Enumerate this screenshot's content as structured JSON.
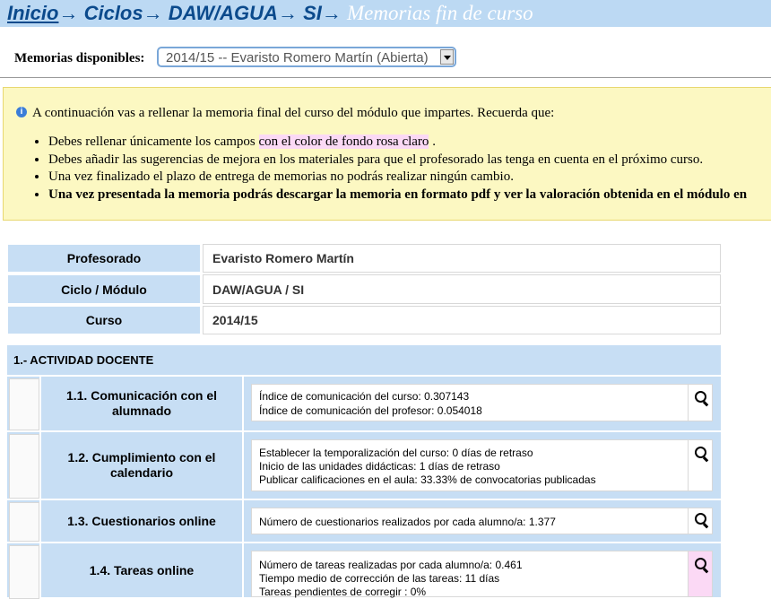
{
  "breadcrumb": {
    "inicio": "Inicio",
    "arrow": "→",
    "ciclos": "Ciclos",
    "modulo": "DAW/AGUA",
    "si": "SI",
    "current": "Memorias fin de curso"
  },
  "selector": {
    "label": "Memorias disponibles:",
    "value": "2014/15 -- Evaristo Romero Martín (Abierta)"
  },
  "info": {
    "intro": "A continuación vas a rellenar la memoria final del curso del módulo que impartes. Recuerda que:",
    "item1_pre": "Debes rellenar únicamente los campos ",
    "item1_pink": "con el color de fondo rosa claro",
    "item1_post": " .",
    "item2": "Debes añadir las sugerencias de mejora en los materiales para que el profesorado las tenga en cuenta en el próximo curso.",
    "item3": "Una vez finalizado el plazo de entrega de memorias no podrás realizar ningún cambio.",
    "item4": "Una vez presentada la memoria podrás descargar la memoria en formato pdf y ver la valoración obtenida en el módulo en"
  },
  "summary": [
    {
      "label": "Profesorado",
      "value": "Evaristo Romero Martín"
    },
    {
      "label": "Ciclo / Módulo",
      "value": "DAW/AGUA / SI"
    },
    {
      "label": "Curso",
      "value": "2014/15"
    }
  ],
  "section1": {
    "title": "1.- ACTIVIDAD DOCENTE",
    "items": [
      {
        "title": "1.1. Comunicación con el alumnado",
        "lines": [
          "Índice de comunicación del curso: 0.307143",
          "Índice de comunicación del profesor: 0.054018"
        ]
      },
      {
        "title": "1.2. Cumplimiento con el calendario",
        "lines": [
          "Establecer la temporalización del curso: 0 días de retraso",
          "Inicio de las unidades didácticas: 1 días de retraso",
          "Publicar calificaciones en el aula: 33.33% de convocatorias publicadas"
        ]
      },
      {
        "title": "1.3. Cuestionarios online",
        "lines": [
          "Número de cuestionarios realizados por cada alumno/a: 1.377"
        ]
      },
      {
        "title": "1.4. Tareas online",
        "lines": [
          "Número de tareas realizadas por cada alumno/a: 0.461",
          "Tiempo medio de corrección de las tareas: 11 días",
          "Tareas pendientes de corregir : 0%"
        ]
      }
    ]
  },
  "colors": {
    "header_bg": "#bcd9f3",
    "cell_bg": "#c7def4",
    "info_bg": "#fcf8c2",
    "pink": "#fbd9f5",
    "link": "#0b4a8c"
  },
  "icons": {
    "info": "info-icon",
    "search": "magnifier-icon",
    "dropdown": "chevron-down-icon"
  }
}
